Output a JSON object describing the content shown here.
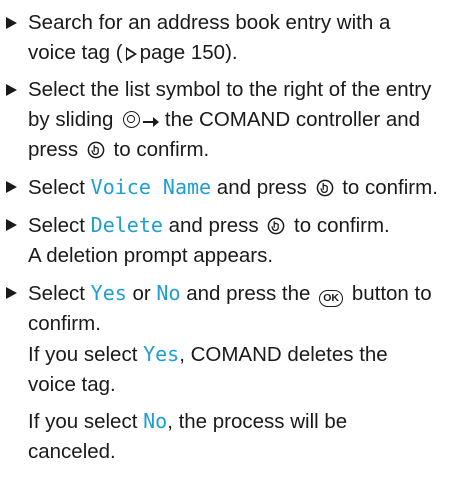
{
  "steps": [
    {
      "text_before": "Search for an address book entry with a voice tag (",
      "page_ref": "page 150",
      "text_after": ")."
    },
    {
      "text_a": "Select the list symbol to the right of the entry by sliding ",
      "text_b": " the COMAND controller and press ",
      "text_c": " to confirm."
    },
    {
      "text_a": "Select ",
      "term": "Voice Name",
      "text_b": " and press ",
      "text_c": " to confirm."
    },
    {
      "text_a": "Select ",
      "term": "Delete",
      "text_b": " and press ",
      "text_c": " to confirm.",
      "result": "A deletion prompt appears."
    },
    {
      "text_a": "Select ",
      "term_yes": "Yes",
      "text_or": " or ",
      "term_no": "No",
      "text_b": " and press the ",
      "ok_label": "OK",
      "text_c": " button to confirm.",
      "result_yes_a": "If you select ",
      "result_yes_term": "Yes",
      "result_yes_b": ", COMAND deletes the voice tag.",
      "result_no_a": "If you select ",
      "result_no_term": "No",
      "result_no_b": ", the process will be canceled."
    }
  ],
  "colors": {
    "text": "#1a1a1a",
    "term": "#1e9ed6"
  },
  "icons": {
    "bullet": "right-triangle-bullet-icon",
    "page_ref": "outline-triangle-reference-icon",
    "slide": "controller-slide-right-icon",
    "press": "controller-press-icon",
    "ok": "ok-button-icon"
  }
}
